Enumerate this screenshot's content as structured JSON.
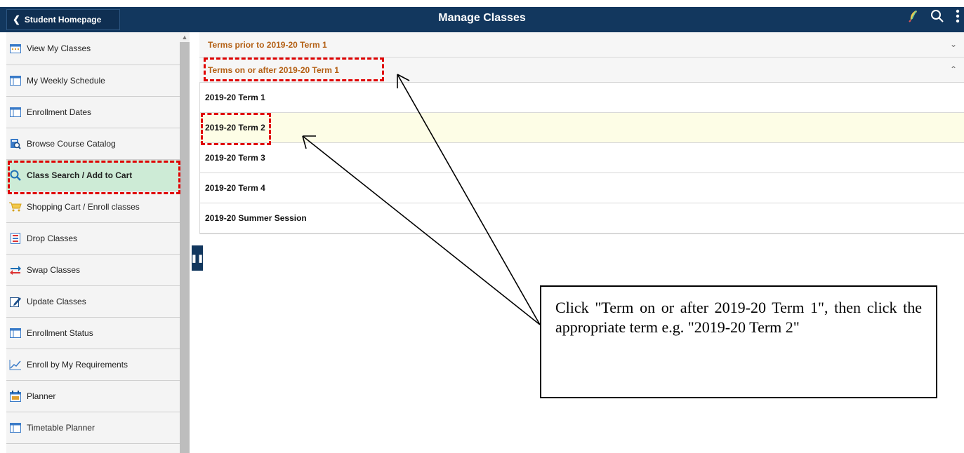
{
  "header": {
    "back_label": "Student Homepage",
    "title": "Manage Classes"
  },
  "sidebar": {
    "items": [
      {
        "label": "View My Classes",
        "icon": "calendar-icon"
      },
      {
        "label": "My Weekly Schedule",
        "icon": "schedule-grid-icon"
      },
      {
        "label": "Enrollment Dates",
        "icon": "schedule-grid-icon"
      },
      {
        "label": "Browse Course Catalog",
        "icon": "catalog-search-icon"
      },
      {
        "label": "Class Search / Add to Cart",
        "icon": "search-icon"
      },
      {
        "label": "Shopping Cart / Enroll classes",
        "icon": "cart-icon"
      },
      {
        "label": "Drop Classes",
        "icon": "drop-icon"
      },
      {
        "label": "Swap Classes",
        "icon": "swap-icon"
      },
      {
        "label": "Update Classes",
        "icon": "edit-icon"
      },
      {
        "label": "Enrollment Status",
        "icon": "schedule-grid-icon"
      },
      {
        "label": "Enroll by My Requirements",
        "icon": "chart-line-icon"
      },
      {
        "label": "Planner",
        "icon": "planner-icon"
      },
      {
        "label": "Timetable Planner",
        "icon": "schedule-grid-icon"
      }
    ],
    "active_index": 4
  },
  "accordion": {
    "prior": "Terms prior to 2019-20 Term 1",
    "after": "Terms on or after 2019-20 Term 1"
  },
  "terms": [
    "2019-20 Term 1",
    "2019-20 Term 2",
    "2019-20 Term 3",
    "2019-20 Term 4",
    "2019-20 Summer Session"
  ],
  "annotation": {
    "text": "Click \"Term on or after 2019-20 Term 1\", then click the appropriate term e.g. \"2019-20 Term 2\""
  },
  "colors": {
    "header": "#12375e",
    "accordion_text": "#b35f13",
    "active_item": "#cdebd6",
    "highlight_row": "#fdfde6",
    "annotation_red": "#e00000"
  }
}
